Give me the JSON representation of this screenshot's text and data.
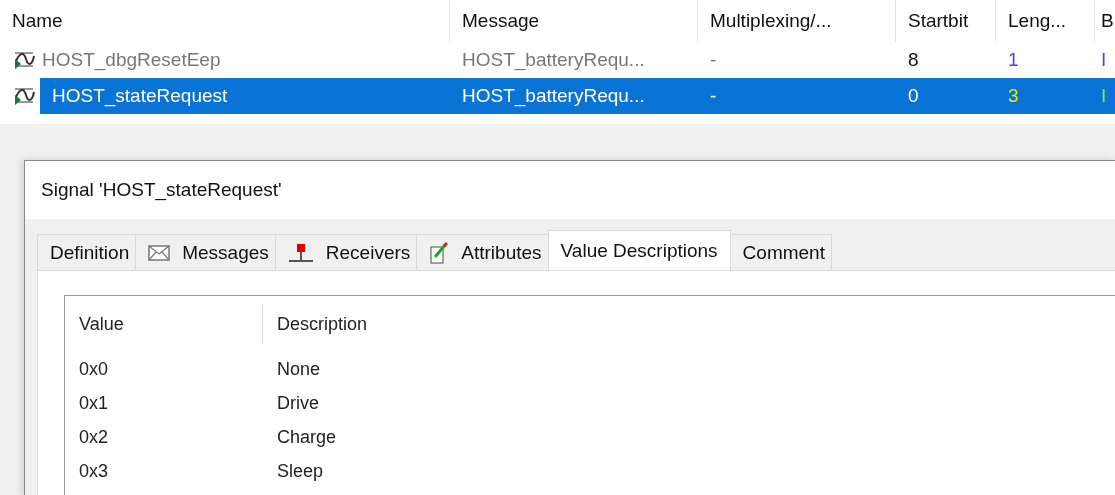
{
  "table": {
    "columns": [
      "Name",
      "Message",
      "Multiplexing/...",
      "Startbit",
      "Leng...",
      "B"
    ],
    "rows": [
      {
        "name": "HOST_dbgResetEep",
        "message": "HOST_batteryRequ...",
        "multiplexing": "-",
        "startbit": "8",
        "length": "1",
        "column_6": "I",
        "selected": false
      },
      {
        "name": "HOST_stateRequest",
        "message": "HOST_batteryRequ...",
        "multiplexing": "-",
        "startbit": "0",
        "length": "3",
        "column_6": "I",
        "selected": true
      }
    ]
  },
  "dialog": {
    "title": "Signal 'HOST_stateRequest'",
    "tabs": [
      {
        "label": "Definition",
        "kind": "plain",
        "selected": false
      },
      {
        "label": "Messages",
        "kind": "envelope",
        "selected": false
      },
      {
        "label": "Receivers",
        "kind": "pin",
        "selected": false
      },
      {
        "label": "Attributes",
        "kind": "pencil",
        "selected": false
      },
      {
        "label": "Value Descriptions",
        "kind": "plain",
        "selected": true
      },
      {
        "label": "Comment",
        "kind": "plain",
        "selected": false
      }
    ],
    "value_table": {
      "columns": [
        "Value",
        "Description"
      ],
      "rows": [
        {
          "value": "0x0",
          "description": "None"
        },
        {
          "value": "0x1",
          "description": "Drive"
        },
        {
          "value": "0x2",
          "description": "Charge"
        },
        {
          "value": "0x3",
          "description": "Sleep"
        }
      ]
    }
  }
}
